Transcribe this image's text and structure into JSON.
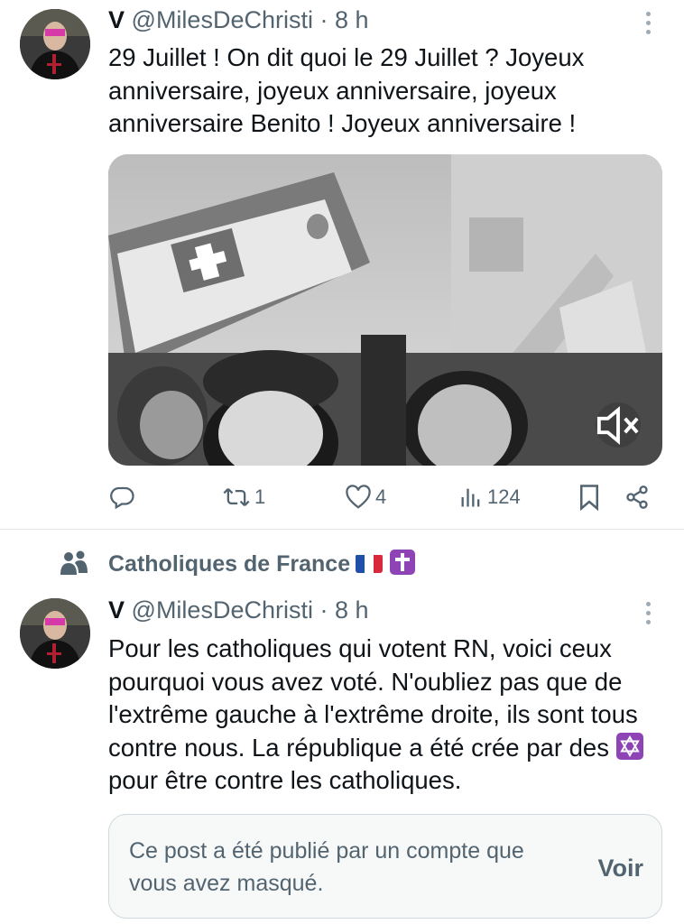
{
  "tweet1": {
    "name": "V",
    "handle": "@MilesDeChristi",
    "separator": "·",
    "time": "8 h",
    "text": "29 Juillet ! On dit quoi le 29 Juillet ? Joyeux anniversaire, joyeux anniversaire, joyeux anniversaire Benito ! Joyeux anniversaire !",
    "media": {
      "type": "video",
      "muted_icon": "speaker-muted-icon"
    },
    "actions": {
      "reply_icon": "reply-icon",
      "retweets": "1",
      "likes": "4",
      "views": "124",
      "bookmark_icon": "bookmark-icon",
      "share_icon": "share-icon"
    }
  },
  "social_context": {
    "icon": "community-icon",
    "label": "Catholiques de France",
    "emojis": [
      "flag-france",
      "latin-cross"
    ]
  },
  "tweet2": {
    "name": "V",
    "handle": "@MilesDeChristi",
    "separator": "·",
    "time": "8 h",
    "text_before_emoji": "Pour les catholiques qui votent RN, voici ceux pourquoi vous avez voté. N'oubliez pas que de l'extrême gauche à l'extrême droite, ils sont tous contre nous. La république a été crée par des",
    "emoji": "star-of-david",
    "text_after_emoji": "pour être contre les catholiques."
  },
  "hidden_notice": {
    "message": "Ce post a été publié par un compte que vous avez masqué.",
    "button": "Voir"
  },
  "colors": {
    "text": "#0f1419",
    "secondary": "#536471",
    "divider": "#e1e4e8",
    "emoji_purple": "#8e44b5"
  }
}
